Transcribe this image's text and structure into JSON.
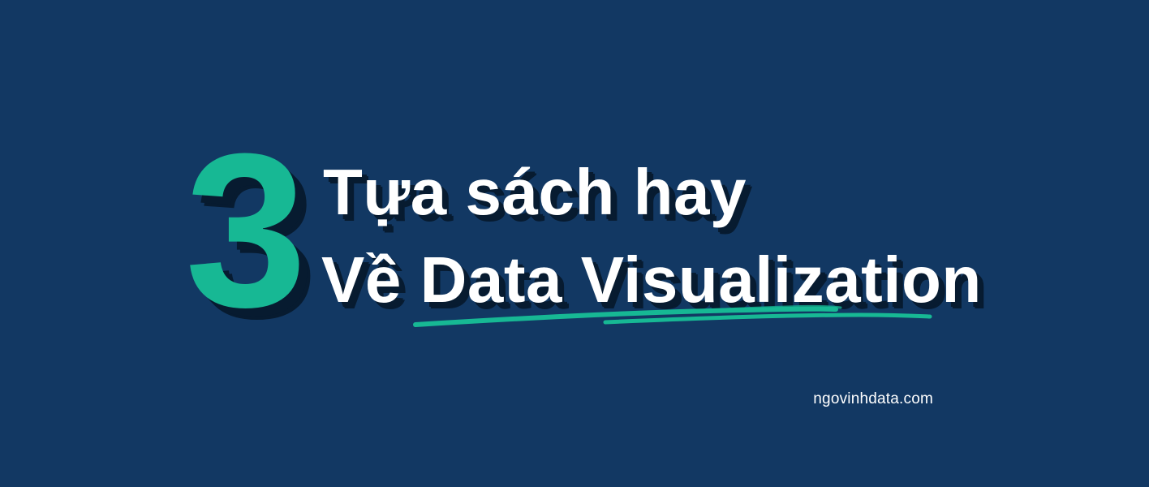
{
  "banner": {
    "number": "3",
    "title_line1": "Tựa sách hay",
    "title_line2": "Về Data Visualization",
    "website": "ngovinhdata.com"
  },
  "colors": {
    "background": "#123863",
    "accent": "#17b894",
    "title_text": "#ffffff",
    "shadow": "#071b30",
    "website_text": "#ffffff"
  }
}
